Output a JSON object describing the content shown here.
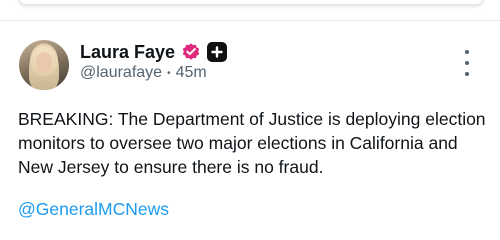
{
  "post": {
    "author_name": "Laura Faye",
    "handle": "@laurafaye",
    "separator": "•",
    "time": "45m",
    "text": "BREAKING: The Department of Justice is deploying election monitors to oversee two major elections in California and New Jersey to ensure there is no fraud.",
    "mention": "@GeneralMCNews"
  },
  "icons": {
    "verified": "verified-badge-icon",
    "plus": "plus-badge-icon",
    "more": "more-options-icon"
  },
  "colors": {
    "verified_badge": "#e0287d",
    "link": "#1d9bf0",
    "muted": "#536471"
  }
}
